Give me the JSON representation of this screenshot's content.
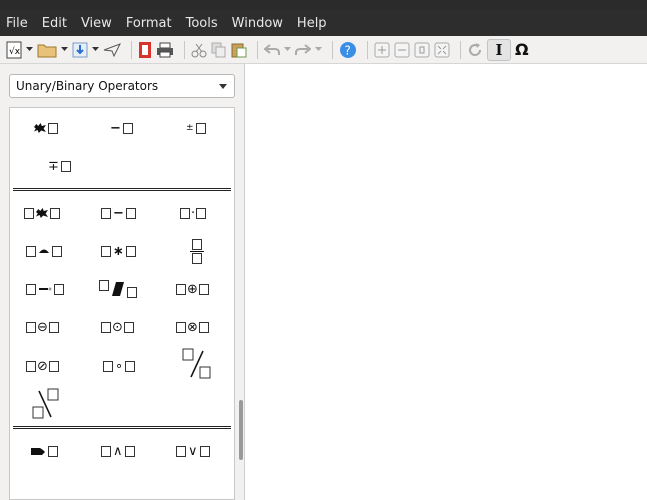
{
  "menu": [
    "File",
    "Edit",
    "View",
    "Format",
    "Tools",
    "Window",
    "Help"
  ],
  "toolbar": {
    "icons": [
      "new-formula-icon",
      "dropdown-arrow-icon",
      "open-folder-icon",
      "dropdown-arrow-icon",
      "save-icon",
      "dropdown-arrow-icon",
      "send-icon",
      "export-pdf-icon",
      "print-icon",
      "cut-icon",
      "copy-icon",
      "paste-icon",
      "undo-icon",
      "dropdown-arrow-icon",
      "redo-icon",
      "dropdown-arrow-icon",
      "help-icon",
      "zoom-in-icon",
      "zoom-out-icon",
      "zoom-100-icon",
      "show-all-icon",
      "update-icon",
      "cursor-icon",
      "symbols-icon"
    ],
    "omega_label": "Ω",
    "cursor_label": "I"
  },
  "panel": {
    "category": "Unary/Binary Operators",
    "symbols": {
      "unary_minus": "−",
      "plus_minus": "±",
      "minus_plus": "∓",
      "binary_minus": "−",
      "center_dot": "·",
      "asterisk": "∗",
      "oplus": "⊕",
      "ominus": "⊖",
      "odot": "⊙",
      "otimes": "⊗",
      "oslash": "⊘",
      "circ": "∘",
      "and": "∧",
      "or": "∨"
    }
  }
}
